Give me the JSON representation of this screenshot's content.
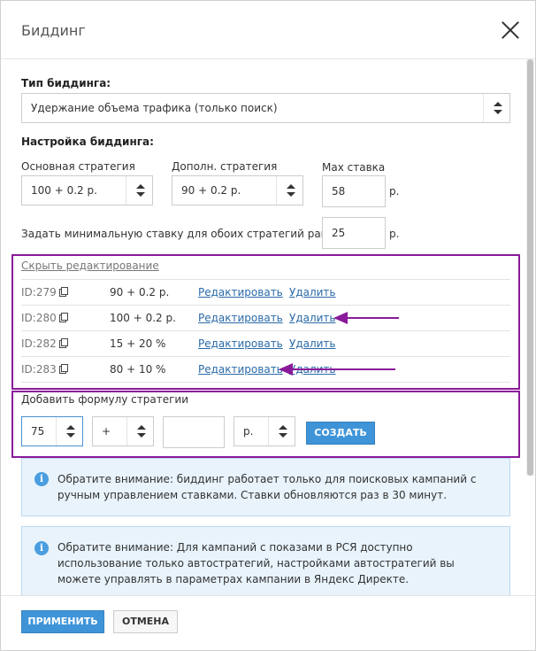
{
  "dialog": {
    "title": "Биддинг"
  },
  "bidding_type": {
    "label": "Тип биддинга:",
    "value": "Удержание объема трафика (только поиск)"
  },
  "settings": {
    "label": "Настройка биддинга:",
    "main_strategy_label": "Основная стратегия",
    "main_strategy_value": "100 + 0.2 р.",
    "extra_strategy_label": "Дополн. стратегия",
    "extra_strategy_value": "90 + 0.2 р.",
    "max_bid_label": "Max ставка",
    "max_bid_value": "58",
    "max_bid_unit": "р.",
    "min_bid_label": "Задать минимальную ставку для обоих стратегий равную",
    "min_bid_value": "25",
    "min_bid_unit": "р."
  },
  "formulas": {
    "hide_link": "Скрыть редактирование",
    "rows": [
      {
        "id": "ID:279",
        "formula": "90 + 0.2 р.",
        "edit": "Редактировать",
        "delete": "Удалить"
      },
      {
        "id": "ID:280",
        "formula": "100 + 0.2 р.",
        "edit": "Редактировать",
        "delete": "Удалить"
      },
      {
        "id": "ID:282",
        "formula": "15 + 20 %",
        "edit": "Редактировать",
        "delete": "Удалить"
      },
      {
        "id": "ID:283",
        "formula": "80 + 10 %",
        "edit": "Редактировать",
        "delete": "Удалить"
      }
    ]
  },
  "add_formula": {
    "label": "Добавить формулу стратегии",
    "value_select": "75",
    "operator_select": "+",
    "amount_input": "",
    "unit_select": "р.",
    "create_label": "СОЗДАТЬ"
  },
  "notices": [
    {
      "text": "Обратите внимание: биддинг работает только для поисковых кампаний с ручным управлением ставками. Ставки обновляются раз в 30 минут."
    },
    {
      "text": "Обратите внимание: Для кампаний с показами в РСЯ доступно использование только автостратегий, настройками автостратегий вы можете управлять в параметрах кампании в Яндекс Директе."
    }
  ],
  "footer": {
    "apply_label": "ПРИМЕНИТЬ",
    "cancel_label": "ОТМЕНА"
  },
  "colors": {
    "accent": "#3f94d8",
    "highlight": "#8a1a9a",
    "notice_bg": "#e8f3fc"
  },
  "icons": {
    "close": "close-icon",
    "copy": "copy-icon",
    "info": "info-icon",
    "arrow": "arrow-left-icon"
  }
}
